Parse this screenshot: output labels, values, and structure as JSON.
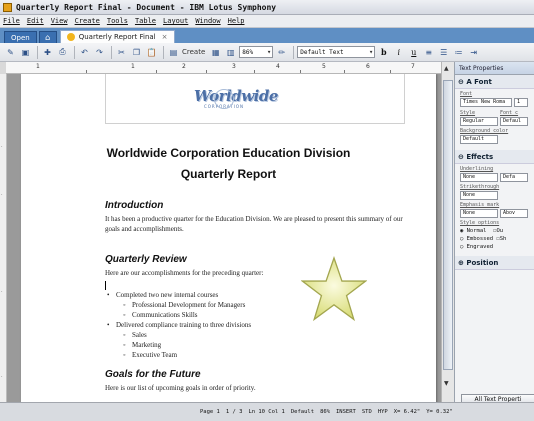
{
  "window": {
    "title": "Quarterly Report Final - Document - IBM Lotus Symphony"
  },
  "menu": [
    "File",
    "Edit",
    "View",
    "Create",
    "Tools",
    "Table",
    "Layout",
    "Window",
    "Help"
  ],
  "tabs": {
    "open_label": "Open",
    "doc_label": "Quarterly Report Final",
    "close_glyph": "×"
  },
  "toolbar": {
    "create_label": "Create",
    "zoom": "86%",
    "style": "Default Text"
  },
  "ruler": {
    "numbers": [
      "1",
      "1",
      "2",
      "3",
      "4",
      "5",
      "6",
      "7"
    ]
  },
  "document": {
    "title": "Worldwide Corporation Education Division",
    "subtitle": "Quarterly Report",
    "logo_main": "Worldwide",
    "logo_sub": "CORPORATION",
    "intro_heading": "Introduction",
    "intro_text": "It has been a productive quarter for the Education Division. We are pleased to present this summary of our goals and accomplishments.",
    "review_heading": "Quarterly Review",
    "review_text": "Here are our accomplishments for the preceding quarter:",
    "bullets": [
      {
        "level": 1,
        "text": "Completed two new internal courses"
      },
      {
        "level": 2,
        "text": "Professional Development for Managers"
      },
      {
        "level": 2,
        "text": "Communications Skills"
      },
      {
        "level": 1,
        "text": "Delivered compliance training to three divisions"
      },
      {
        "level": 2,
        "text": "Sales"
      },
      {
        "level": 2,
        "text": "Marketing"
      },
      {
        "level": 2,
        "text": "Executive Team"
      }
    ],
    "goals_heading": "Goals for the Future",
    "goals_text": "Here is our list of upcoming goals in order of priority."
  },
  "panel": {
    "title": "Text Properties",
    "font_section": "A Font",
    "font_label": "Font",
    "font_value": "Times New Roma",
    "font_size": "1",
    "style_label": "Style",
    "font_color_label": "Font c",
    "style_value": "Regular",
    "color_value": "Defaul",
    "bg_label": "Background color",
    "bg_value": "Default",
    "effects_section": "Effects",
    "underlining_label": "Underlining",
    "underlining_value": "None",
    "underlining_color": "Defa",
    "strike_label": "Strikethrough",
    "strike_value": "None",
    "emphasis_label": "Emphasis mark",
    "emphasis_value": "None",
    "emphasis_pos": "Abov",
    "style_options_label": "Style options",
    "opt_normal": "Normal",
    "opt_embossed": "Embossed",
    "opt_engraved": "Engraved",
    "chk_outline": "Ou",
    "chk_shadow": "Sh",
    "position_section": "Position",
    "all_btn": "All Text Properti"
  },
  "status": {
    "page": "Page 1",
    "pages": "1 / 3",
    "line": "Ln 10 Col 1",
    "style": "Default",
    "zoom": "86%",
    "ins": "INSERT",
    "std": "STD",
    "hyp": "HYP",
    "pos_x": "X= 6.42\"",
    "pos_y": "Y= 0.32\""
  }
}
